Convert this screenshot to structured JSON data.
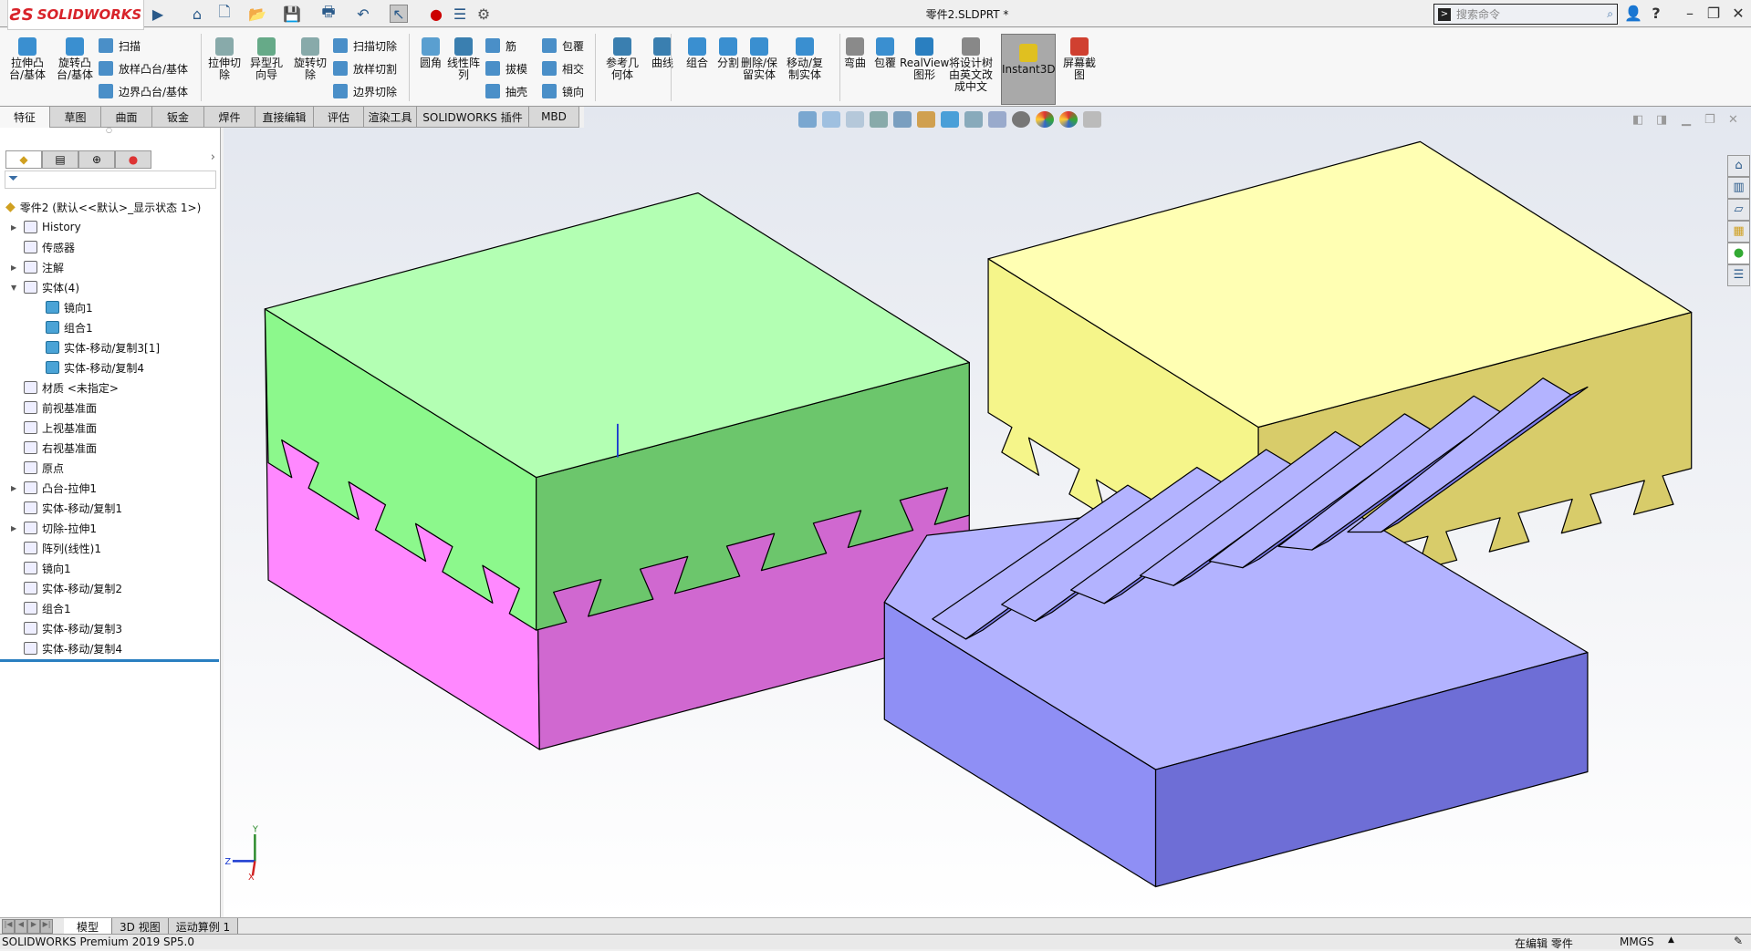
{
  "app": {
    "logo": "SOLIDWORKS",
    "title": "零件2.SLDPRT *",
    "search_placeholder": "搜索命令"
  },
  "quick_access": [
    "home-icon",
    "new-icon",
    "open-icon",
    "save-icon",
    "print-icon",
    "undo-icon",
    "select-icon",
    "rebuild-icon",
    "file-properties-icon",
    "options-icon"
  ],
  "ribbon": {
    "large": [
      {
        "label": "拉伸凸\n台/基体",
        "color": "#3a8fd0"
      },
      {
        "label": "旋转凸\n台/基体",
        "color": "#3a8fd0"
      },
      {
        "label": "拉伸切\n除",
        "color": "#8aa"
      },
      {
        "label": "异型孔\n向导",
        "color": "#6a8"
      },
      {
        "label": "旋转切\n除",
        "color": "#8aa"
      },
      {
        "label": "圆角",
        "color": "#5a9fd0"
      },
      {
        "label": "线性阵\n列",
        "color": "#3a7fb0"
      },
      {
        "label": "参考几\n何体",
        "color": "#3a7fb0"
      },
      {
        "label": "曲线",
        "color": "#3a7fb0"
      },
      {
        "label": "组合",
        "color": "#3a8fd0"
      },
      {
        "label": "分割",
        "color": "#3a8fd0"
      },
      {
        "label": "删除/保\n留实体",
        "color": "#3a8fd0"
      },
      {
        "label": "移动/复\n制实体",
        "color": "#3a8fd0"
      },
      {
        "label": "弯曲",
        "color": "#8a8a8a"
      },
      {
        "label": "包覆",
        "color": "#3a8fd0"
      },
      {
        "label": "RealView\n图形",
        "color": "#2a7fc0"
      },
      {
        "label": "将设计树\n由英文改\n成中文",
        "color": "#888"
      },
      {
        "label": "Instant3D",
        "color": "#e0c020"
      },
      {
        "label": "屏幕截\n图",
        "color": "#d04030"
      }
    ],
    "small": [
      "扫描",
      "放样凸台/基体",
      "边界凸台/基体",
      "扫描切除",
      "放样切割",
      "边界切除",
      "筋",
      "拔模",
      "抽壳",
      "包覆",
      "相交",
      "镜向"
    ]
  },
  "tabs": [
    "特征",
    "草图",
    "曲面",
    "钣金",
    "焊件",
    "直接编辑",
    "评估",
    "渲染工具",
    "SOLIDWORKS 插件",
    "MBD"
  ],
  "active_tab": "特征",
  "feature_tree": {
    "root": "零件2  (默认<<默认>_显示状态 1>)",
    "items": [
      {
        "label": "History",
        "level": 0,
        "expandable": true
      },
      {
        "label": "传感器",
        "level": 0
      },
      {
        "label": "注解",
        "level": 0,
        "expandable": true
      },
      {
        "label": "实体(4)",
        "level": 0,
        "expanded": true
      },
      {
        "label": "镜向1",
        "level": 1,
        "body": true
      },
      {
        "label": "组合1",
        "level": 1,
        "body": true
      },
      {
        "label": "实体-移动/复制3[1]",
        "level": 1,
        "body": true
      },
      {
        "label": "实体-移动/复制4",
        "level": 1,
        "body": true
      },
      {
        "label": "材质 <未指定>",
        "level": 0
      },
      {
        "label": "前视基准面",
        "level": 0
      },
      {
        "label": "上视基准面",
        "level": 0
      },
      {
        "label": "右视基准面",
        "level": 0
      },
      {
        "label": "原点",
        "level": 0
      },
      {
        "label": "凸台-拉伸1",
        "level": 0,
        "expandable": true
      },
      {
        "label": "实体-移动/复制1",
        "level": 0
      },
      {
        "label": "切除-拉伸1",
        "level": 0,
        "expandable": true
      },
      {
        "label": "阵列(线性)1",
        "level": 0
      },
      {
        "label": "镜向1",
        "level": 0
      },
      {
        "label": "实体-移动/复制2",
        "level": 0
      },
      {
        "label": "组合1",
        "level": 0
      },
      {
        "label": "实体-移动/复制3",
        "level": 0
      },
      {
        "label": "实体-移动/复制4",
        "level": 0
      }
    ]
  },
  "bottom_tabs": [
    "模型",
    "3D 视图",
    "运动算例 1"
  ],
  "status": {
    "version": "SOLIDWORKS Premium 2019 SP5.0",
    "editing": "在编辑 零件",
    "units": "MMGS"
  },
  "triad": {
    "x": "X",
    "y": "Y",
    "z": "Z"
  },
  "colors": {
    "green_top": "#b3ffb3",
    "green_side": "#8cf88c",
    "green_right": "#6cc66c",
    "pink_left": "#ff88ff",
    "pink_right": "#d068d0",
    "yellow_top": "#ffffb3",
    "yellow_left": "#f5f58a",
    "yellow_right": "#d8cc6a",
    "purple_top": "#b3b3ff",
    "purple_left": "#8f8ff5",
    "purple_right": "#6e6ed6"
  }
}
